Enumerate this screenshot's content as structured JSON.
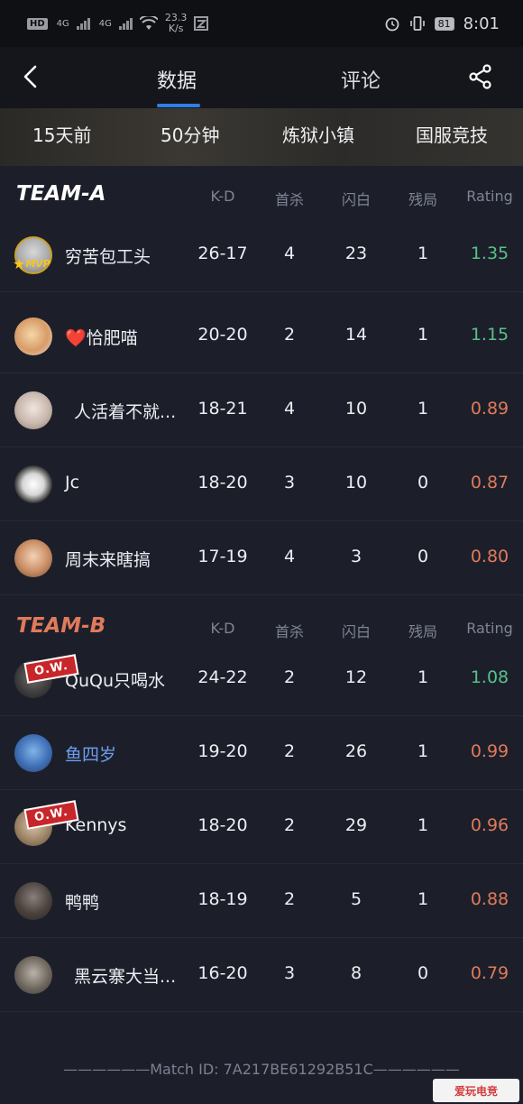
{
  "status_bar": {
    "hd": "HD",
    "net1": "4G",
    "net2": "4G",
    "speed_value": "23.3",
    "speed_unit": "K/s",
    "battery": "81",
    "time": "8:01"
  },
  "nav": {
    "tab_data": "数据",
    "tab_comments": "评论"
  },
  "match_info": {
    "time_ago": "15天前",
    "duration": "50分钟",
    "map": "炼狱小镇",
    "mode": "国服竞技"
  },
  "columns": [
    "K-D",
    "首杀",
    "闪白",
    "残局",
    "Rating"
  ],
  "colors": {
    "good_rating": "#57c18a",
    "bad_rating": "#e07a5a",
    "team_b": "#e07a5a",
    "tab_accent": "#2f7de6"
  },
  "mvp_label": "MVP",
  "ow_label": "O.W.",
  "team_a": {
    "name": "TEAM-A",
    "players": [
      {
        "name": "穷苦包工头",
        "kd": "26-17",
        "first_kills": "4",
        "flashes": "23",
        "clutches": "1",
        "rating": "1.35",
        "mvp": true
      },
      {
        "name": "❤️恰肥喵",
        "kd": "20-20",
        "first_kills": "2",
        "flashes": "14",
        "clutches": "1",
        "rating": "1.15"
      },
      {
        "name": "人活着不就...",
        "kd": "18-21",
        "first_kills": "4",
        "flashes": "10",
        "clutches": "1",
        "rating": "0.89"
      },
      {
        "name": "Jc",
        "kd": "18-20",
        "first_kills": "3",
        "flashes": "10",
        "clutches": "0",
        "rating": "0.87"
      },
      {
        "name": "周末来瞎搞",
        "kd": "17-19",
        "first_kills": "4",
        "flashes": "3",
        "clutches": "0",
        "rating": "0.80"
      }
    ]
  },
  "team_b": {
    "name": "TEAM-B",
    "players": [
      {
        "name": "QuQu只喝水",
        "kd": "24-22",
        "first_kills": "2",
        "flashes": "12",
        "clutches": "1",
        "rating": "1.08",
        "ow": true
      },
      {
        "name": "鱼四岁",
        "kd": "19-20",
        "first_kills": "2",
        "flashes": "26",
        "clutches": "1",
        "rating": "0.99"
      },
      {
        "name": "Kennys",
        "kd": "18-20",
        "first_kills": "2",
        "flashes": "29",
        "clutches": "1",
        "rating": "0.96",
        "ow": true
      },
      {
        "name": "鸭鸭",
        "kd": "18-19",
        "first_kills": "2",
        "flashes": "5",
        "clutches": "1",
        "rating": "0.88"
      },
      {
        "name": "黑云寨大当...",
        "kd": "16-20",
        "first_kills": "3",
        "flashes": "8",
        "clutches": "0",
        "rating": "0.79"
      }
    ]
  },
  "footer": {
    "match_id": "——————Match ID: 7A217BE61292B51C——————"
  },
  "watermark": "爱玩电竞"
}
